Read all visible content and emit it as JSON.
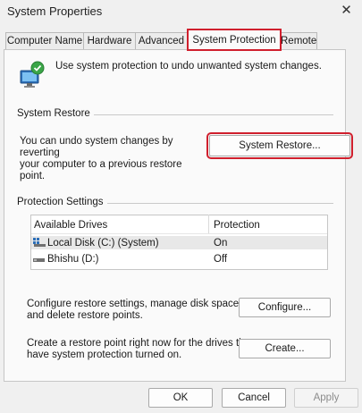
{
  "window": {
    "title": "System Properties",
    "close_glyph": "✕"
  },
  "tabs": [
    {
      "label": "Computer Name",
      "active": false
    },
    {
      "label": "Hardware",
      "active": false
    },
    {
      "label": "Advanced",
      "active": false
    },
    {
      "label": "System Protection",
      "active": true
    },
    {
      "label": "Remote",
      "active": false
    }
  ],
  "intro": {
    "icon": "system-protection-icon",
    "text": "Use system protection to undo unwanted system changes."
  },
  "system_restore": {
    "group_label": "System Restore",
    "description_line1": "You can undo system changes by reverting",
    "description_line2": "your computer to a previous restore point.",
    "button_label": "System Restore..."
  },
  "protection_settings": {
    "group_label": "Protection Settings",
    "columns": [
      "Available Drives",
      "Protection"
    ],
    "drives": [
      {
        "name": "Local Disk (C:) (System)",
        "protection": "On",
        "icon": "system-drive-icon",
        "selected": true
      },
      {
        "name": "Bhishu (D:)",
        "protection": "Off",
        "icon": "drive-icon",
        "selected": false
      }
    ],
    "configure_text_line1": "Configure restore settings, manage disk space,",
    "configure_text_line2": "and delete restore points.",
    "configure_button": "Configure...",
    "create_text_line1": "Create a restore point right now for the drives that",
    "create_text_line2": "have system protection turned on.",
    "create_button": "Create..."
  },
  "footer": {
    "ok": "OK",
    "cancel": "Cancel",
    "apply": "Apply"
  },
  "colors": {
    "highlight_outline": "#d01f2d",
    "window_bg": "#f0f0f0",
    "panel_bg": "#fafafa"
  }
}
